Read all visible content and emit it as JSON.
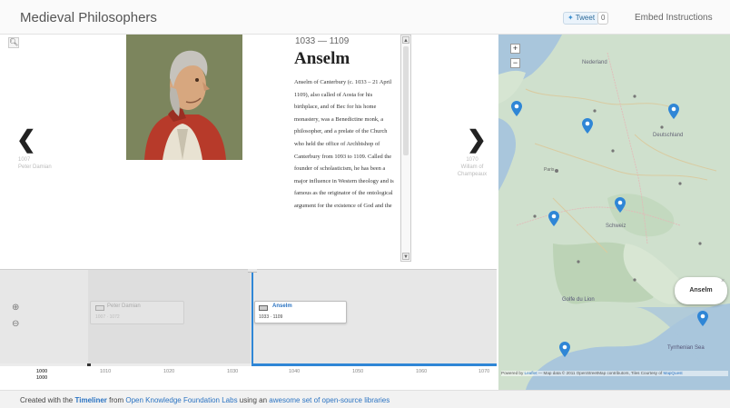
{
  "header": {
    "title": "Medieval Philosophers",
    "tweet_label": "Tweet",
    "tweet_count": "0",
    "embed_label": "Embed Instructions"
  },
  "story": {
    "zoom_icon": "search-icon",
    "prev": {
      "date": "1007",
      "title": "Peter Damian"
    },
    "next": {
      "date": "1070",
      "title": "Willam of Champeaux"
    },
    "slide": {
      "dates": "1033 — 1109",
      "title": "Anselm",
      "text": "Anselm of Canterbury (c. 1033 – 21 April 1109), also called of Aosta for his birthplace, and of Bec for his home monastery, was a Benedictine monk, a philosopher, and a prelate of the Church who held the office of Archbishop of Canterbury from 1093 to 1109. Called the founder of scholasticism, he has been a major influence in Western theology and is famous as the originator of the ontological argument for the existence of God and the"
    }
  },
  "timeline": {
    "markers": [
      {
        "label": "Peter Damian",
        "sub": "1007 · 1072"
      },
      {
        "label": "Anselm",
        "sub": "1033 · 1109"
      }
    ],
    "years": [
      "1000",
      "1010",
      "1020",
      "1030",
      "1040",
      "1050",
      "1060",
      "1070"
    ],
    "sub_year": "1000"
  },
  "map": {
    "popup_label": "Anselm",
    "attribution_prefix": "Powered by",
    "attribution_link": "Leaflet",
    "attribution_rest": " — Map data © 2011 OpenStreetMap contributors, Tiles Courtesy of",
    "attribution_tiles": "MapQuest",
    "labels": [
      "Nederland",
      "Deutschland",
      "Golfe du Lion",
      "Tyrrhenian Sea",
      "Schweiz",
      "Paris"
    ],
    "colors": {
      "water": "#a9c6dc",
      "land": "#cfe0cd",
      "pin": "#2f86d6"
    }
  },
  "footer": {
    "prefix": "Created with the ",
    "timeliner": "Timeliner",
    "from": " from ",
    "okfn": "Open Knowledge Foundation Labs",
    "using": " using an ",
    "libs": "awesome set of open-source libraries"
  }
}
